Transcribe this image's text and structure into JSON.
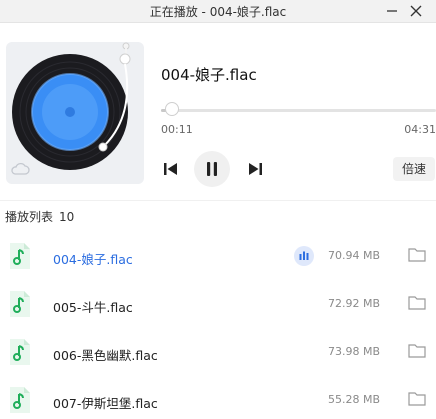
{
  "window": {
    "title": "正在播放 - 004-娘子.flac",
    "minimize_glyph": "—",
    "close_glyph": "✕"
  },
  "player": {
    "track_title": "004-娘子.flac",
    "current_time": "00:11",
    "total_time": "04:31",
    "progress_fraction": 0.04,
    "speed_label": "倍速",
    "state": "playing",
    "icons": {
      "prev": "skip-previous-icon",
      "pause": "pause-icon",
      "next": "skip-next-icon",
      "cover_cloud": "cloud-icon"
    }
  },
  "playlist": {
    "label": "播放列表",
    "count": "10",
    "items": [
      {
        "name": "004-娘子.flac",
        "size": "70.94 MB",
        "active": true
      },
      {
        "name": "005-斗牛.flac",
        "size": "72.92 MB",
        "active": false
      },
      {
        "name": "006-黑色幽默.flac",
        "size": "73.98 MB",
        "active": false
      },
      {
        "name": "007-伊斯坦堡.flac",
        "size": "55.28 MB",
        "active": false
      }
    ]
  },
  "colors": {
    "accent": "#2b6de0",
    "file_icon": "#1fae5a",
    "disc_blue": "#3a8ef5"
  }
}
